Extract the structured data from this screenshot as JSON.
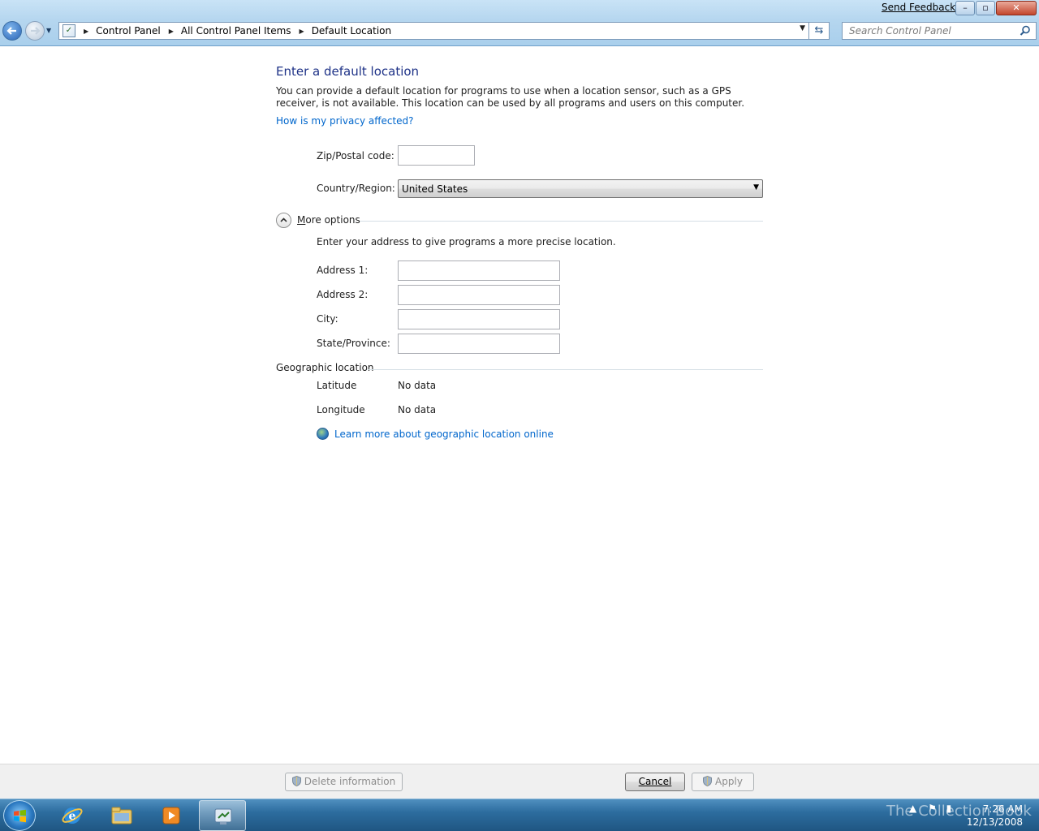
{
  "window": {
    "send_feedback": "Send Feedback",
    "minimize": "–",
    "restore": "▫",
    "close": "✕"
  },
  "addressbar": {
    "crumbs": [
      "Control Panel",
      "All Control Panel Items",
      "Default Location"
    ],
    "search_placeholder": "Search Control Panel"
  },
  "page": {
    "title": "Enter a default location",
    "description": "You can provide a default location for programs to use when a location sensor, such as a GPS receiver, is not available. This location can be used by all programs and users on this computer.",
    "privacy_link": "How is my privacy affected?",
    "zip_label": "Zip/Postal code:",
    "zip_value": "",
    "country_label": "Country/Region:",
    "country_value": "United States",
    "more_options_label": "More options",
    "more_options_mnemonic": "M",
    "more_options_rest": "ore options",
    "address_hint": "Enter your address to give programs a more precise location.",
    "address1_label": "Address 1:",
    "address2_label": "Address 2:",
    "city_label": "City:",
    "state_label": "State/Province:",
    "geo_header": "Geographic location",
    "latitude_label": "Latitude",
    "latitude_value": "No data",
    "longitude_label": "Longitude",
    "longitude_value": "No data",
    "learn_more_link": "Learn more about geographic location online"
  },
  "footer": {
    "delete_button": "Delete information",
    "cancel_button": "Cancel",
    "apply_button": "Apply"
  },
  "taskbar": {
    "items": [
      "start",
      "internet-explorer",
      "windows-explorer",
      "media-player",
      "control-panel"
    ],
    "clock_time": "7:26 AM",
    "clock_date": "12/13/2008",
    "watermark": "The Collection Book"
  },
  "colors": {
    "heading": "#1e3287",
    "link": "#0066cc",
    "taskbar": "#2d6d9f"
  }
}
